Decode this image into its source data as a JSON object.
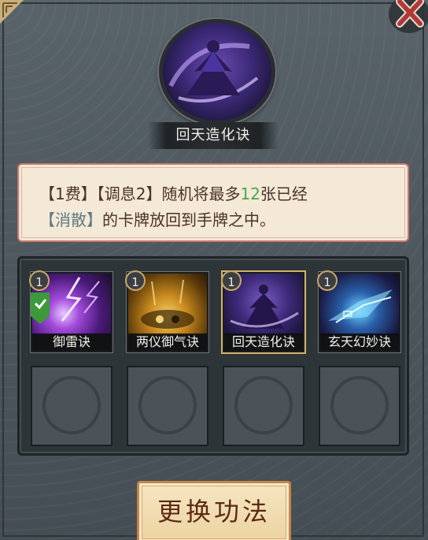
{
  "skill": {
    "name": "回天造化诀",
    "icon": "purple-robed-figure-icon"
  },
  "description": {
    "line1_parts": [
      {
        "text": "【1费】【调息2】随机将最多",
        "style": "normal"
      },
      {
        "text": "12",
        "style": "num"
      },
      {
        "text": "张已经",
        "style": "normal"
      }
    ],
    "line2_parts": [
      {
        "text": "【消散】",
        "style": "kw"
      },
      {
        "text": "的卡牌放回到手牌之中。",
        "style": "normal"
      }
    ]
  },
  "cards": [
    {
      "label": "御雷诀",
      "cost": "1",
      "equipped": true,
      "selected": false,
      "theme": "purple-lightning"
    },
    {
      "label": "两仪御气诀",
      "cost": "1",
      "equipped": false,
      "selected": false,
      "theme": "golden-yin-yang"
    },
    {
      "label": "回天造化诀",
      "cost": "1",
      "equipped": false,
      "selected": true,
      "theme": "purple-robed-figure"
    },
    {
      "label": "玄天幻妙诀",
      "cost": "1",
      "equipped": false,
      "selected": false,
      "theme": "blue-wing"
    }
  ],
  "empty_slots": 4,
  "buttons": {
    "change": "更换功法",
    "close": "close-icon"
  },
  "colors": {
    "keyword": "#5a7a84",
    "number": "#4aa84a",
    "cost_ring": "#c7a868",
    "selected_border": "#d6b26a"
  }
}
